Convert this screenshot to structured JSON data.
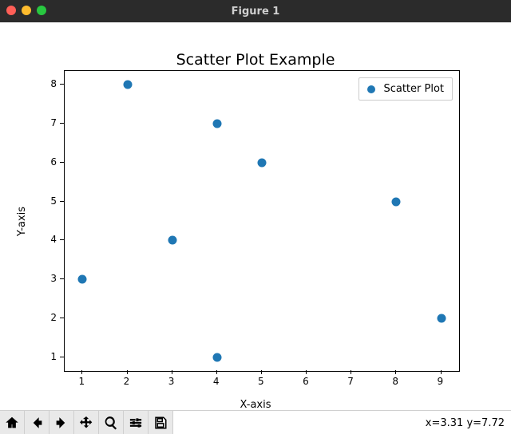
{
  "window": {
    "title": "Figure 1"
  },
  "chart_data": {
    "type": "scatter",
    "title": "Scatter Plot Example",
    "xlabel": "X-axis",
    "ylabel": "Y-axis",
    "xlim": [
      0.6,
      9.4
    ],
    "ylim": [
      0.65,
      8.35
    ],
    "xticks": [
      1,
      2,
      3,
      4,
      5,
      6,
      7,
      8,
      9
    ],
    "yticks": [
      1,
      2,
      3,
      4,
      5,
      6,
      7,
      8
    ],
    "series": [
      {
        "name": "Scatter Plot",
        "x": [
          1,
          2,
          3,
          4,
          4,
          5,
          8,
          9
        ],
        "y": [
          3,
          8,
          4,
          7,
          1,
          6,
          5,
          2
        ]
      }
    ]
  },
  "legend": {
    "label": "Scatter Plot"
  },
  "toolbar": {
    "buttons": [
      {
        "id": "home",
        "label": "Home"
      },
      {
        "id": "back",
        "label": "Back"
      },
      {
        "id": "forward",
        "label": "Forward"
      },
      {
        "id": "pan",
        "label": "Pan"
      },
      {
        "id": "zoom",
        "label": "Zoom"
      },
      {
        "id": "configure",
        "label": "Configure subplots"
      },
      {
        "id": "save",
        "label": "Save"
      }
    ]
  },
  "status": {
    "coords": "x=3.31 y=7.72"
  }
}
